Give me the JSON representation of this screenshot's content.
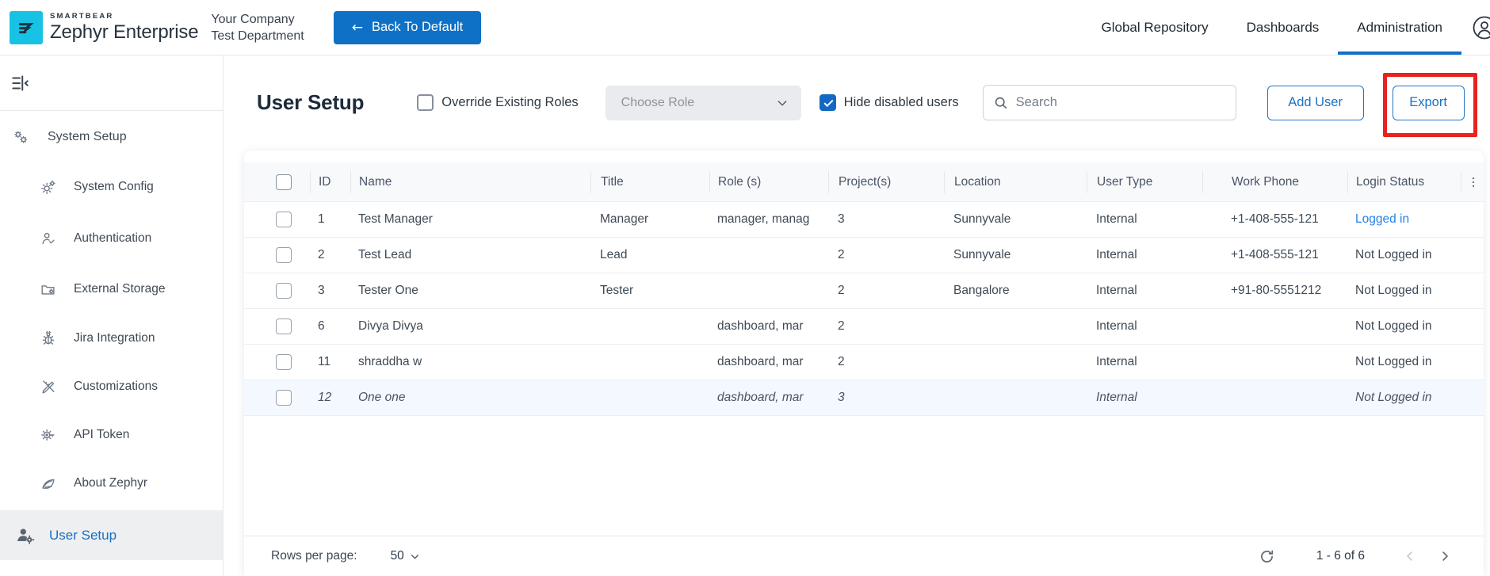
{
  "header": {
    "brand": {
      "smartbear": "SMARTBEAR",
      "product": "Zephyr Enterprise"
    },
    "company": "Your Company",
    "department": "Test Department",
    "back_button": "Back To Default",
    "back_arrow": "←",
    "nav": [
      {
        "label": "Global Repository",
        "active": false
      },
      {
        "label": "Dashboards",
        "active": false
      },
      {
        "label": "Administration",
        "active": true
      }
    ]
  },
  "sidebar": {
    "section": {
      "label": "System Setup",
      "icon": "gears-icon"
    },
    "items": [
      {
        "label": "System Config",
        "icon": "gear-cog-icon"
      },
      {
        "label": "Authentication",
        "icon": "user-check-icon"
      },
      {
        "label": "External Storage",
        "icon": "folder-gear-icon"
      },
      {
        "label": "Jira Integration",
        "icon": "bug-icon"
      },
      {
        "label": "Customizations",
        "icon": "pencil-ruler-icon"
      },
      {
        "label": "API Token",
        "icon": "gear-key-icon"
      },
      {
        "label": "About Zephyr",
        "icon": "feather-icon"
      }
    ],
    "active_item": {
      "label": "User Setup",
      "icon": "user-gear-icon"
    }
  },
  "toolbar": {
    "title": "User Setup",
    "override_label": "Override Existing Roles",
    "override_checked": false,
    "choose_role_placeholder": "Choose Role",
    "hide_disabled_label": "Hide disabled users",
    "hide_disabled_checked": true,
    "search_placeholder": "Search",
    "add_user_label": "Add User",
    "export_label": "Export"
  },
  "table": {
    "columns": [
      "ID",
      "Name",
      "Title",
      "Role (s)",
      "Project(s)",
      "Location",
      "User Type",
      "Work Phone",
      "Login Status"
    ],
    "rows": [
      {
        "id": "1",
        "name": "Test Manager",
        "title": "Manager",
        "roles": "manager, manag",
        "projects": "3",
        "location": "Sunnyvale",
        "user_type": "Internal",
        "work_phone": "+1-408-555-121",
        "login_status": "Logged in",
        "logged_in": true,
        "highlighted": false
      },
      {
        "id": "2",
        "name": "Test Lead",
        "title": "Lead",
        "roles": "",
        "projects": "2",
        "location": "Sunnyvale",
        "user_type": "Internal",
        "work_phone": "+1-408-555-121",
        "login_status": "Not Logged in",
        "logged_in": false,
        "highlighted": false
      },
      {
        "id": "3",
        "name": "Tester One",
        "title": "Tester",
        "roles": "",
        "projects": "2",
        "location": "Bangalore",
        "user_type": "Internal",
        "work_phone": "+91-80-5551212",
        "login_status": "Not Logged in",
        "logged_in": false,
        "highlighted": false
      },
      {
        "id": "6",
        "name": "Divya Divya",
        "title": "",
        "roles": "dashboard, mar",
        "projects": "2",
        "location": "",
        "user_type": "Internal",
        "work_phone": "",
        "login_status": "Not Logged in",
        "logged_in": false,
        "highlighted": false
      },
      {
        "id": "11",
        "name": "shraddha w",
        "title": "",
        "roles": "dashboard, mar",
        "projects": "2",
        "location": "",
        "user_type": "Internal",
        "work_phone": "",
        "login_status": "Not Logged in",
        "logged_in": false,
        "highlighted": false
      },
      {
        "id": "12",
        "name": "One one",
        "title": "",
        "roles": "dashboard, mar",
        "projects": "3",
        "location": "",
        "user_type": "Internal",
        "work_phone": "",
        "login_status": "Not Logged in",
        "logged_in": false,
        "highlighted": true
      }
    ]
  },
  "footer": {
    "rows_per_page_label": "Rows per page:",
    "rows_per_page_value": "50",
    "range_label": "1 - 6 of 6"
  },
  "colors": {
    "accent_blue": "#0f71c6",
    "checkbox_blue": "#1268c3",
    "link_blue": "#2582e8",
    "active_nav_underline": "#0f6fc5",
    "highlight_red": "#e8221f",
    "logo_teal": "#17c2e4",
    "row_highlight": "#f3f9fe"
  }
}
